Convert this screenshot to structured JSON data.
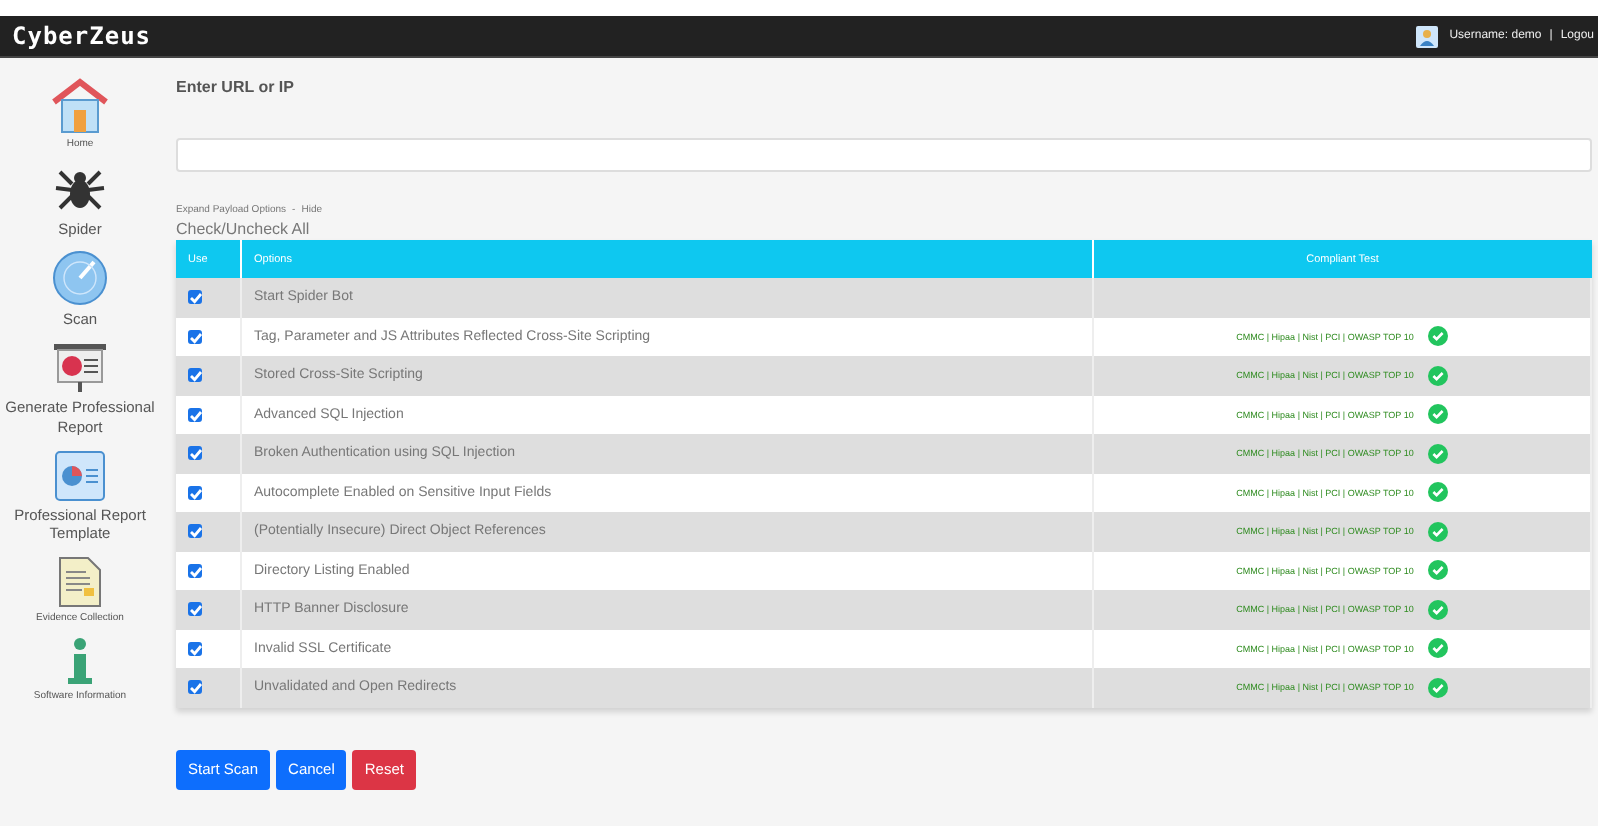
{
  "header": {
    "logo": "CyberZeus",
    "username": "Username: demo",
    "separator": "|",
    "logout": "Logou"
  },
  "sidebar": {
    "items": [
      {
        "label": "Home",
        "kind": "small"
      },
      {
        "label": "Spider",
        "kind": "normal"
      },
      {
        "label": "Scan",
        "kind": "normal"
      },
      {
        "label": "Generate Professional Report",
        "kind": "normal"
      },
      {
        "label": "Professional Report Template",
        "kind": "normal"
      },
      {
        "label": "Evidence Collection",
        "kind": "small"
      },
      {
        "label": "Software Information",
        "kind": "small"
      }
    ]
  },
  "url_field": {
    "label": "Enter URL or IP"
  },
  "payload_links": {
    "expand": "Expand Payload Options",
    "separator": "-",
    "hide": "Hide"
  },
  "check_all": "Check/Uncheck All",
  "table": {
    "columns": [
      "Use",
      "Options",
      "Compliant Test"
    ],
    "rows": [
      {
        "checked": true,
        "option": "Start Spider Bot"
      },
      {
        "checked": true,
        "option": "Tag, Parameter and JS Attributes Reflected Cross-Site Scripting",
        "compliance": "CMMC | Hipaa | Nist | PCI | OWASP TOP 10",
        "passed": true
      },
      {
        "checked": true,
        "option": "Stored Cross-Site Scripting",
        "compliance": "CMMC | Hipaa | Nist | PCI | OWASP TOP 10",
        "passed": true
      },
      {
        "checked": true,
        "option": "Advanced SQL Injection",
        "compliance": "CMMC | Hipaa | Nist | PCI | OWASP TOP 10",
        "passed": true
      },
      {
        "checked": true,
        "option": "Broken Authentication using SQL Injection",
        "compliance": "CMMC | Hipaa | Nist | PCI | OWASP TOP 10",
        "passed": true
      },
      {
        "checked": true,
        "option": "Autocomplete Enabled on Sensitive Input Fields",
        "compliance": "CMMC | Hipaa | Nist | PCI | OWASP TOP 10",
        "passed": true
      },
      {
        "checked": true,
        "option": "(Potentially Insecure) Direct Object References",
        "compliance": "CMMC | Hipaa | Nist | PCI | OWASP TOP 10",
        "passed": true
      },
      {
        "checked": true,
        "option": "Directory Listing Enabled",
        "compliance": "CMMC | Hipaa | Nist | PCI | OWASP TOP 10",
        "passed": true
      },
      {
        "checked": true,
        "option": "HTTP Banner Disclosure",
        "compliance": "CMMC | Hipaa | Nist | PCI | OWASP TOP 10",
        "passed": true
      },
      {
        "checked": true,
        "option": "Invalid SSL Certificate",
        "compliance": "CMMC | Hipaa | Nist | PCI | OWASP TOP 10",
        "passed": true
      },
      {
        "checked": true,
        "option": "Unvalidated and Open Redirects",
        "compliance": "CMMC | Hipaa | Nist | PCI | OWASP TOP 10",
        "passed": true
      }
    ]
  },
  "buttons": [
    {
      "label": "Start Scan",
      "kind": "primary"
    },
    {
      "label": "Cancel",
      "kind": "primary"
    },
    {
      "label": "Reset",
      "kind": "danger"
    }
  ]
}
